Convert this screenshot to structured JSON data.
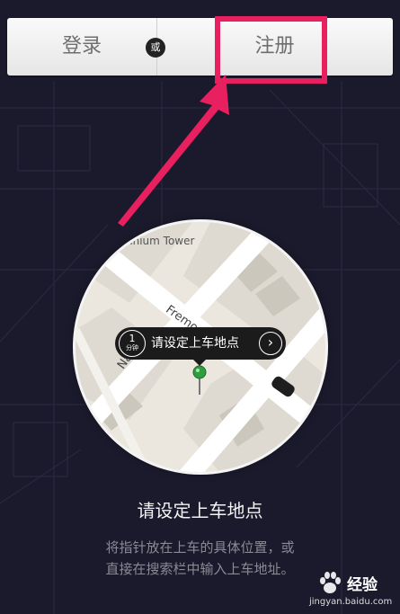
{
  "header": {
    "login_label": "登录",
    "or_label": "或",
    "register_label": "注册"
  },
  "map": {
    "tower_label": "nnium Tower",
    "street_fremont": "Fremon",
    "street_n": "Na"
  },
  "pickup": {
    "eta_value": "1",
    "eta_unit": "分钟",
    "label": "请设定上车地点",
    "go_icon": "chevron-right-icon"
  },
  "content": {
    "title": "请设定上车地点",
    "desc_line1": "将指针放在上车的具体位置，或",
    "desc_line2": "直接在搜索栏中输入上车地址。"
  },
  "watermark": {
    "brand": "经验",
    "url": "jingyan.baidu.com"
  },
  "colors": {
    "background": "#1b1a2c",
    "highlight": "#e8205f",
    "pin": "#2e9e3e"
  }
}
